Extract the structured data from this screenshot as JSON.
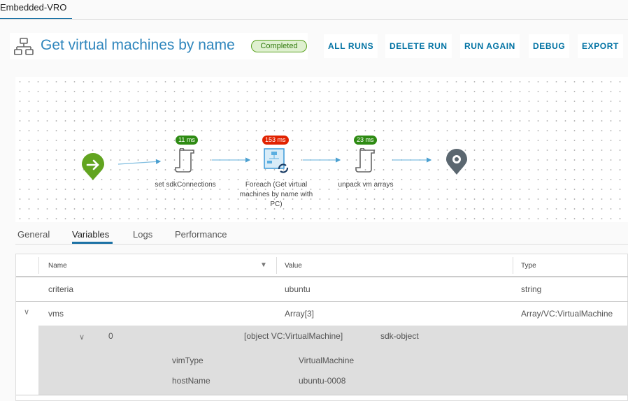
{
  "top_tab": "Embedded-VRO",
  "header": {
    "title": "Get virtual machines by name",
    "status": "Completed",
    "icon": "workflow-icon"
  },
  "actions": [
    "ALL RUNS",
    "DELETE RUN",
    "RUN AGAIN",
    "DEBUG",
    "EXPORT"
  ],
  "colors": {
    "accent": "#0072a3",
    "ok": "#2e8b13",
    "slow": "#e12200",
    "start": "#62a420",
    "end": "#5b6770"
  },
  "flow": {
    "nodes": [
      {
        "label": "set sdkConnections",
        "duration": "11 ms",
        "status": "ok",
        "icon": "script-icon"
      },
      {
        "label": "Foreach (Get virtual machines by name with PC)",
        "duration": "153 ms",
        "status": "slow",
        "icon": "foreach-icon"
      },
      {
        "label": "unpack vm arrays",
        "duration": "23 ms",
        "status": "ok",
        "icon": "script-icon"
      }
    ]
  },
  "tabs": [
    "General",
    "Variables",
    "Logs",
    "Performance"
  ],
  "active_tab": "Variables",
  "table": {
    "headers": [
      "Name",
      "Value",
      "Type"
    ],
    "rows": [
      {
        "name": "criteria",
        "value": "ubuntu",
        "type": "string"
      },
      {
        "name": "vms",
        "value": "Array[3]",
        "type": "Array/VC:VirtualMachine",
        "expanded": true
      }
    ],
    "child": {
      "index": "0",
      "value": "[object VC:VirtualMachine]",
      "type": "sdk-object",
      "props": [
        {
          "key": "vimType",
          "value": "VirtualMachine"
        },
        {
          "key": "hostName",
          "value": "ubuntu-0008"
        }
      ]
    }
  }
}
